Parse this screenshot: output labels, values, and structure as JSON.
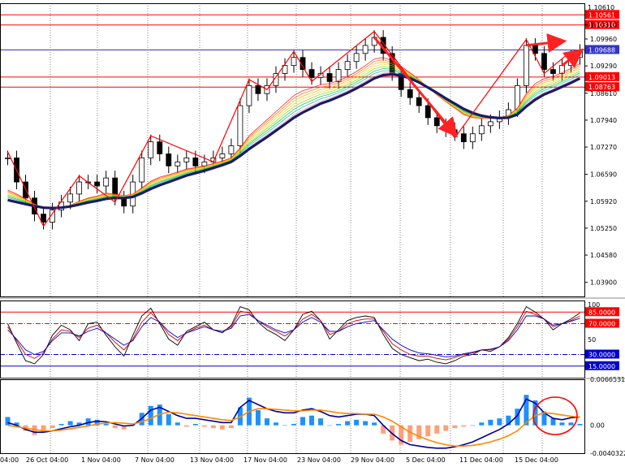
{
  "chart_data": [
    {
      "type": "candlestick",
      "panel": "price",
      "y_ticks": [
        "1.10310",
        "1.09960",
        "1.09290",
        "1.08610",
        "1.07940",
        "1.07270",
        "1.06590",
        "1.05920",
        "1.05250",
        "1.04580",
        "1.03900"
      ],
      "y_top_label": "1.10610",
      "ylim": [
        1.0355,
        1.1085
      ],
      "hlines": [
        {
          "value": 1.10561,
          "label": "1.10561",
          "color": "#ff0000"
        },
        {
          "value": 1.1031,
          "label": "1.10310",
          "color": "#ff0000"
        },
        {
          "value": 1.09688,
          "label": "1.09688",
          "color": "#3333cc"
        },
        {
          "value": 1.09013,
          "label": "1.09013",
          "color": "#ff0000"
        },
        {
          "value": 1.08763,
          "label": "1.08763",
          "color": "#ff0000"
        }
      ],
      "close": [
        1.07,
        1.064,
        1.06,
        1.056,
        1.054,
        1.057,
        1.059,
        1.061,
        1.064,
        1.064,
        1.063,
        1.065,
        1.06,
        1.058,
        1.064,
        1.07,
        1.074,
        1.071,
        1.068,
        1.069,
        1.07,
        1.068,
        1.069,
        1.07,
        1.071,
        1.073,
        1.083,
        1.088,
        1.086,
        1.088,
        1.091,
        1.093,
        1.095,
        1.092,
        1.09,
        1.091,
        1.089,
        1.092,
        1.094,
        1.096,
        1.098,
        1.1,
        1.096,
        1.091,
        1.087,
        1.085,
        1.083,
        1.08,
        1.078,
        1.077,
        1.076,
        1.074,
        1.076,
        1.078,
        1.079,
        1.08,
        1.082,
        1.088,
        1.098,
        1.096,
        1.092,
        1.091,
        1.093,
        1.095,
        1.0965
      ],
      "fast_ma": [
        1.062,
        1.061,
        1.0598,
        1.0585,
        1.0575,
        1.0572,
        1.0575,
        1.0582,
        1.0592,
        1.06,
        1.0605,
        1.0612,
        1.061,
        1.0606,
        1.061,
        1.0625,
        1.0642,
        1.0652,
        1.0658,
        1.0665,
        1.0672,
        1.0676,
        1.068,
        1.0686,
        1.0692,
        1.07,
        1.0725,
        1.0755,
        1.0775,
        1.0795,
        1.0815,
        1.0835,
        1.0855,
        1.0867,
        1.0874,
        1.0882,
        1.0885,
        1.0892,
        1.0902,
        1.0915,
        1.093,
        1.0946,
        1.095,
        1.0942,
        1.0928,
        1.0912,
        1.0895,
        1.0876,
        1.0857,
        1.084,
        1.0824,
        1.0808,
        1.08,
        1.0798,
        1.0798,
        1.08,
        1.0806,
        1.0824,
        1.086,
        1.0885,
        1.0897,
        1.0903,
        1.0912,
        1.0923,
        1.0935
      ],
      "slow_ma": [
        1.0595,
        1.059,
        1.0585,
        1.058,
        1.0576,
        1.0575,
        1.0576,
        1.0579,
        1.0584,
        1.0589,
        1.0593,
        1.0598,
        1.06,
        1.06,
        1.0603,
        1.0612,
        1.0623,
        1.0632,
        1.064,
        1.0648,
        1.0656,
        1.0662,
        1.0668,
        1.0675,
        1.0682,
        1.069,
        1.0705,
        1.0722,
        1.0737,
        1.0752,
        1.0768,
        1.0784,
        1.08,
        1.0813,
        1.0824,
        1.0835,
        1.0843,
        1.0852,
        1.0862,
        1.0873,
        1.0885,
        1.0898,
        1.0906,
        1.0908,
        1.0905,
        1.0898,
        1.0888,
        1.0875,
        1.0862,
        1.0848,
        1.0835,
        1.0822,
        1.0812,
        1.0805,
        1.0801,
        1.0799,
        1.08,
        1.0808,
        1.0828,
        1.0845,
        1.0858,
        1.0867,
        1.0877,
        1.0887,
        1.0898
      ]
    },
    {
      "type": "line",
      "panel": "oscillator",
      "y_top_label": "100",
      "y_mid_label": "50",
      "ylim": [
        0,
        100
      ],
      "levels": [
        {
          "value": 85,
          "label": "85.0000",
          "color": "#ff0000"
        },
        {
          "value": 70,
          "label": "70.0000",
          "color": "#ff0000"
        },
        {
          "value": 30,
          "label": "30.0000",
          "color": "#0000cc"
        },
        {
          "value": 15,
          "label": "15.0000",
          "color": "#0000cc"
        }
      ],
      "series": [
        {
          "color": "#000000",
          "values": [
            70,
            45,
            22,
            18,
            30,
            55,
            68,
            62,
            48,
            70,
            72,
            55,
            40,
            28,
            55,
            80,
            90,
            70,
            50,
            42,
            60,
            66,
            72,
            62,
            58,
            68,
            92,
            88,
            72,
            62,
            56,
            48,
            62,
            82,
            86,
            74,
            50,
            62,
            74,
            78,
            80,
            78,
            56,
            38,
            30,
            26,
            22,
            24,
            20,
            18,
            22,
            28,
            30,
            36,
            34,
            40,
            52,
            70,
            92,
            85,
            76,
            62,
            70,
            76,
            84
          ]
        },
        {
          "color": "#cc0000",
          "values": [
            66,
            48,
            30,
            25,
            32,
            50,
            62,
            60,
            52,
            64,
            68,
            58,
            46,
            36,
            50,
            72,
            84,
            72,
            56,
            48,
            58,
            64,
            68,
            62,
            60,
            66,
            86,
            84,
            74,
            66,
            60,
            54,
            62,
            76,
            82,
            74,
            56,
            60,
            70,
            74,
            76,
            76,
            60,
            44,
            36,
            30,
            28,
            28,
            25,
            23,
            26,
            30,
            32,
            36,
            36,
            40,
            50,
            66,
            86,
            82,
            76,
            66,
            70,
            74,
            80
          ]
        },
        {
          "color": "#0000cc",
          "values": [
            62,
            50,
            36,
            30,
            34,
            48,
            58,
            58,
            54,
            60,
            64,
            58,
            50,
            42,
            48,
            66,
            78,
            72,
            60,
            52,
            58,
            62,
            66,
            62,
            60,
            64,
            80,
            82,
            74,
            68,
            62,
            58,
            62,
            72,
            78,
            72,
            60,
            60,
            66,
            70,
            72,
            74,
            62,
            50,
            42,
            36,
            32,
            31,
            29,
            27,
            28,
            31,
            33,
            36,
            37,
            40,
            48,
            62,
            80,
            80,
            76,
            68,
            70,
            73,
            77
          ]
        }
      ]
    },
    {
      "type": "bar+line",
      "panel": "macd",
      "y_ticks": [
        "0.0066531",
        "0.00",
        "-0.0040322"
      ],
      "ylim": [
        -0.0040322,
        0.0066531
      ],
      "histogram": [
        0.0012,
        0.0004,
        -0.0008,
        -0.0014,
        -0.001,
        -0.0004,
        0.0002,
        0.0006,
        0.0004,
        0.001,
        0.0008,
        0.0002,
        -0.0004,
        -0.0006,
        0.0,
        0.0018,
        0.0028,
        0.003,
        0.0016,
        0.0004,
        -0.0002,
        0.0002,
        -0.0002,
        -0.0004,
        -0.0006,
        -0.0004,
        0.0026,
        0.004,
        0.0022,
        0.001,
        0.0004,
        0.0,
        0.0002,
        0.0012,
        0.0014,
        0.001,
        0.0,
        0.0002,
        0.0006,
        0.0008,
        0.0006,
        0.0004,
        -0.0012,
        -0.0022,
        -0.0028,
        -0.0024,
        -0.002,
        -0.0016,
        -0.0012,
        -0.0008,
        -0.0004,
        -0.0002,
        0.0,
        0.0004,
        0.0008,
        0.001,
        0.0014,
        0.0024,
        0.0044,
        0.0036,
        0.002,
        0.001,
        0.0004,
        0.0004,
        0.0002
      ],
      "series": [
        {
          "color": "#000099",
          "values": [
            0.0004,
            0.0,
            -0.0006,
            -0.001,
            -0.001,
            -0.0008,
            -0.0005,
            -0.0002,
            0.0,
            0.0004,
            0.0006,
            0.0005,
            0.0002,
            -0.0001,
            0.0,
            0.001,
            0.0022,
            0.0026,
            0.002,
            0.0014,
            0.001,
            0.001,
            0.0008,
            0.0006,
            0.0004,
            0.0004,
            0.0026,
            0.0036,
            0.003,
            0.0024,
            0.002,
            0.0018,
            0.0018,
            0.0022,
            0.0024,
            0.002,
            0.0014,
            0.0012,
            0.0014,
            0.0016,
            0.0016,
            0.0014,
            0.0,
            -0.0012,
            -0.0022,
            -0.0028,
            -0.003,
            -0.0032,
            -0.0033,
            -0.0033,
            -0.0031,
            -0.0028,
            -0.0024,
            -0.0018,
            -0.0012,
            -0.0006,
            0.0002,
            0.0014,
            0.0038,
            0.0032,
            0.0018,
            0.001,
            0.0008,
            0.0011,
            0.0012
          ]
        },
        {
          "color": "#ff8800",
          "values": [
            0.0,
            -0.0002,
            -0.0004,
            -0.0006,
            -0.0008,
            -0.0008,
            -0.0007,
            -0.0005,
            -0.0003,
            -0.0001,
            0.0002,
            0.0003,
            0.0004,
            0.0003,
            0.0002,
            0.0005,
            0.001,
            0.0016,
            0.0019,
            0.0018,
            0.0016,
            0.0014,
            0.0012,
            0.001,
            0.0008,
            0.0007,
            0.0012,
            0.002,
            0.0024,
            0.0024,
            0.0023,
            0.0022,
            0.0021,
            0.0021,
            0.0022,
            0.0022,
            0.002,
            0.0018,
            0.0017,
            0.0017,
            0.0016,
            0.0016,
            0.0012,
            0.0006,
            -0.0002,
            -0.001,
            -0.0016,
            -0.0021,
            -0.0025,
            -0.0028,
            -0.003,
            -0.003,
            -0.0029,
            -0.0027,
            -0.0024,
            -0.002,
            -0.0015,
            -0.0008,
            0.0004,
            0.0014,
            0.0018,
            0.0017,
            0.0015,
            0.0013,
            0.0012
          ]
        }
      ]
    }
  ],
  "x_axis": {
    "labels": [
      "04:00",
      "26 Oct 04:00",
      "1 Nov 04:00",
      "7 Nov 04:00",
      "13 Nov 04:00",
      "17 Nov 04:00",
      "23 Nov 04:00",
      "29 Nov 04:00",
      "5 Dec 04:00",
      "11 Dec 04:00",
      "15 Dec 04:00"
    ]
  },
  "annotations": {
    "zigzag_color": "#ff0000",
    "trend_arrow_color": "#ff2222",
    "highlight_circle_color": "#ff0000"
  },
  "colors": {
    "grid": "#666666",
    "axis_label_bg_red": "#ff0000",
    "axis_label_bg_blue": "#2222cc",
    "bull_candle": "#000000",
    "bear_candle": "#000000",
    "hist_pos": "#1e90ff",
    "hist_neg": "#ffa07a"
  }
}
